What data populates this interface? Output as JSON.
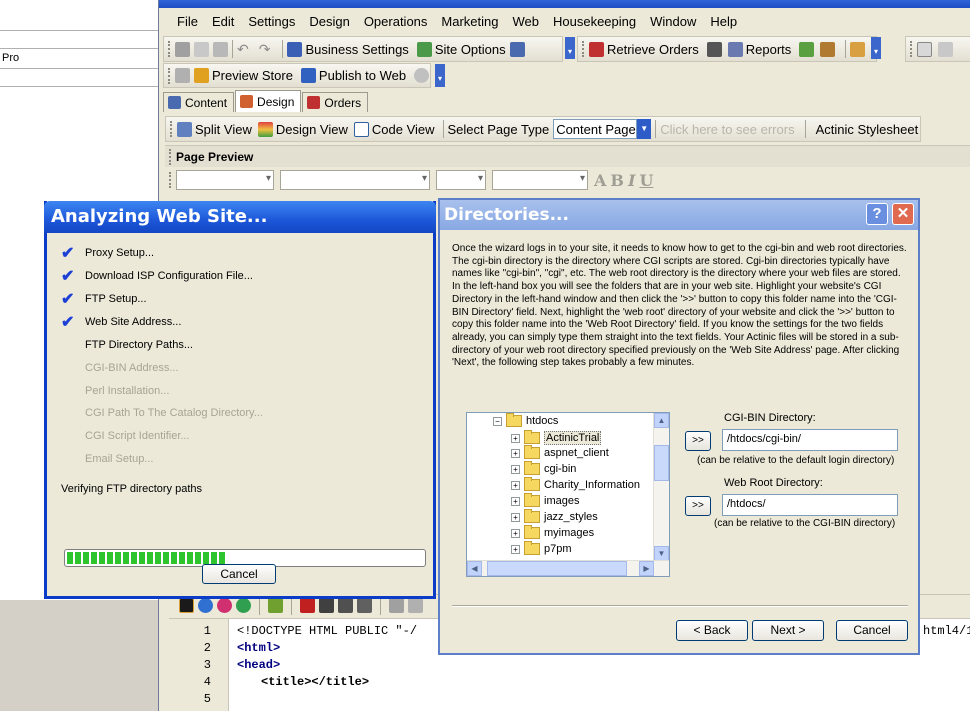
{
  "left_app": {
    "text": "Pro"
  },
  "menu": [
    "File",
    "Edit",
    "Settings",
    "Design",
    "Operations",
    "Marketing",
    "Web",
    "Housekeeping",
    "Window",
    "Help"
  ],
  "toolbar1": {
    "business_settings": "Business Settings",
    "site_options": "Site Options",
    "retrieve_orders": "Retrieve Orders",
    "reports": "Reports"
  },
  "toolbar2": {
    "preview_store": "Preview Store",
    "publish_to_web": "Publish to Web"
  },
  "tabs": [
    "Content",
    "Design",
    "Orders"
  ],
  "design_toolbar": {
    "split_view": "Split View",
    "design_view": "Design View",
    "code_view": "Code View",
    "select_page_type": "Select Page Type",
    "page_type_value": "Content Page",
    "errors_link": "Click here to see errors",
    "stylesheet": "Actinic Stylesheet"
  },
  "page_preview": "Page Preview",
  "code": {
    "line_numbers": [
      "1",
      "2",
      "3",
      "4",
      "5"
    ],
    "doctype": "<!DOCTYPE HTML PUBLIC \"-/",
    "doctype_tail": "html4/1",
    "html": "<html>",
    "head": "<head>",
    "title": "<title></title>"
  },
  "analyzing": {
    "title": "Analyzing Web Site...",
    "steps_done": [
      "Proxy Setup...",
      "Download ISP Configuration File...",
      "FTP Setup...",
      "Web Site Address..."
    ],
    "step_current": "FTP Directory Paths...",
    "steps_pending": [
      "CGI-BIN Address...",
      "Perl Installation...",
      "CGI Path To The Catalog Directory...",
      "CGI Script Identifier...",
      "Email Setup..."
    ],
    "status": "Verifying FTP directory paths",
    "progress_percent": 45,
    "cancel": "Cancel"
  },
  "directories": {
    "title": "Directories...",
    "help": "?",
    "close": "✕",
    "description": "Once the wizard logs in to your site, it needs to know how to get to the cgi-bin and web root directories. The cgi-bin directory is the directory where CGI scripts are stored. Cgi-bin directories typically have names like \"cgi-bin\", \"cgi\", etc. The web root directory is the directory where your web files are stored. In the left-hand box you will see the folders that are in your web site. Highlight your website's CGI Directory in the left-hand window and then click the '>>' button to copy this folder name into the 'CGI-BIN Directory' field. Next, highlight the 'web root' directory of your website and click the '>>' button to copy this folder name into the 'Web Root Directory' field. If you know the settings for the two fields already, you can simply type them straight into the text fields. Your Actinic files will be stored in a sub-directory of your web root directory specified previously on the 'Web Site Address' page. After clicking 'Next', the following step takes probably a few minutes.",
    "tree_root": "htdocs",
    "tree_items": [
      "ActinicTrial",
      "aspnet_client",
      "cgi-bin",
      "Charity_Information",
      "images",
      "jazz_styles",
      "myimages",
      "p7pm"
    ],
    "copy_button": ">>",
    "cgi_label": "CGI-BIN Directory:",
    "cgi_value": "/htdocs/cgi-bin/",
    "cgi_note": "(can be relative to the default login directory)",
    "web_label": "Web Root Directory:",
    "web_value": "/htdocs/",
    "web_note": "(can be relative to the CGI-BIN directory)",
    "back": "< Back",
    "next": "Next >",
    "cancel": "Cancel"
  },
  "colors": {
    "xp_blue": "#1d57d9",
    "progress_green": "#2ec42e",
    "dialog_bg": "#ece9d8"
  }
}
